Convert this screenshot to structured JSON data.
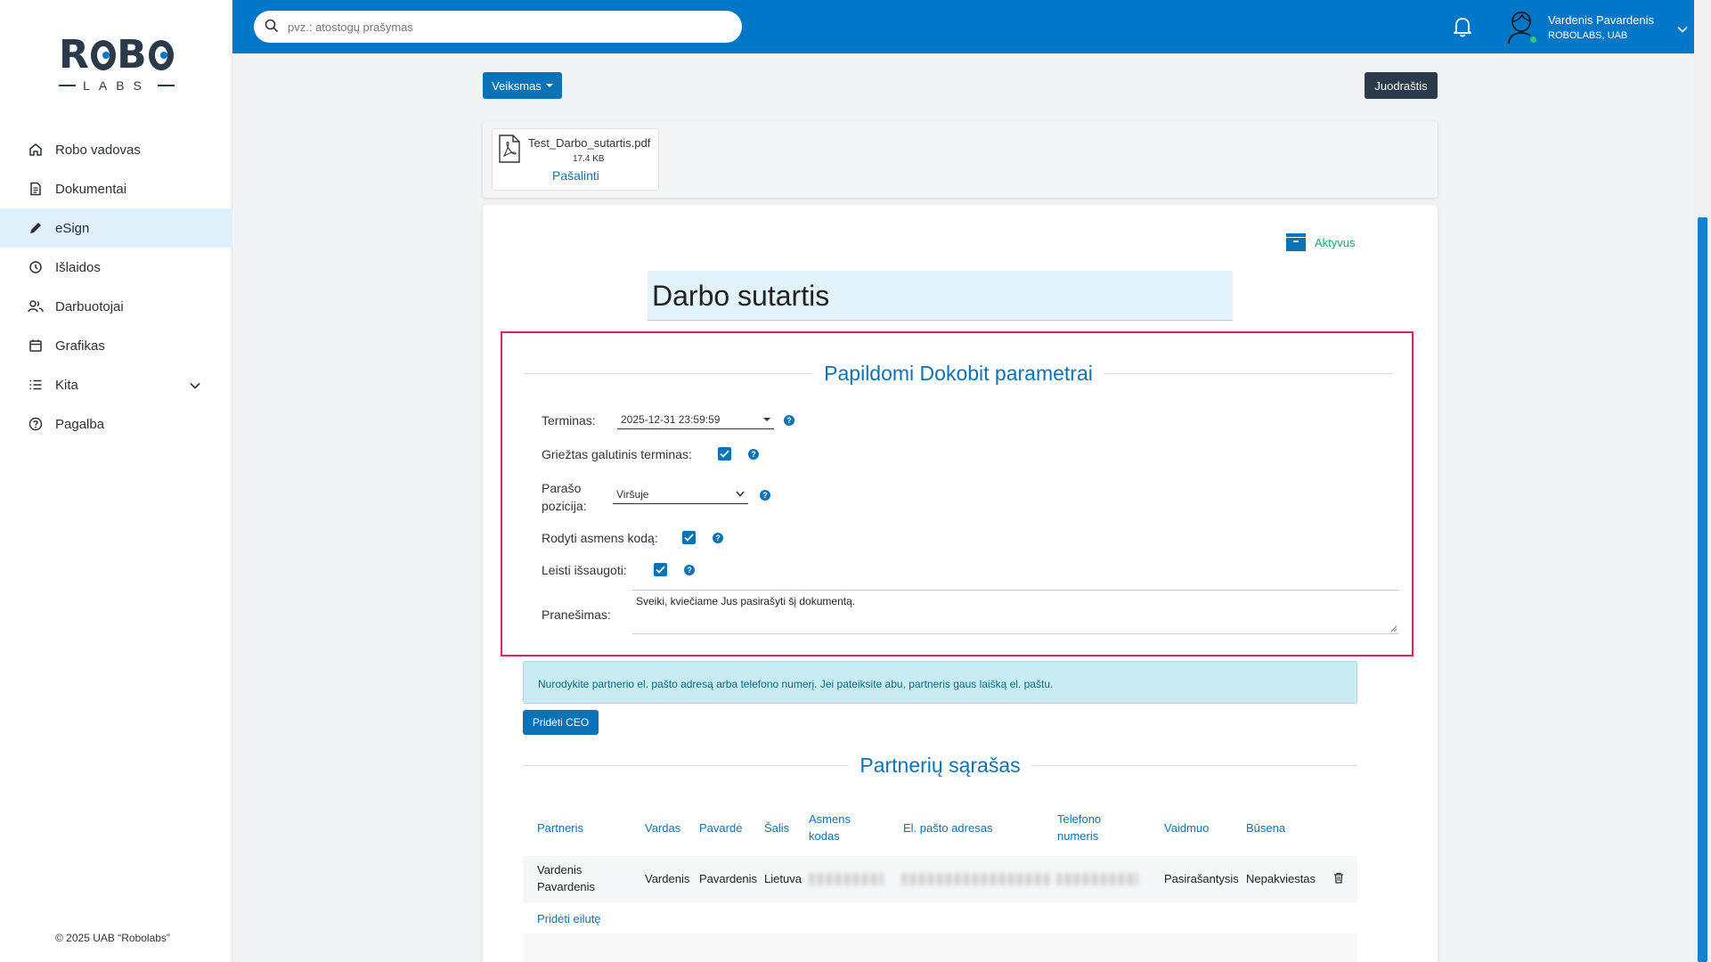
{
  "app": {
    "logo_top": "ROBO",
    "logo_bottom": "LABS",
    "copyright": "© 2025 UAB “Robolabs”"
  },
  "sidebar": {
    "items": [
      {
        "label": "Robo vadovas",
        "icon": "home-icon"
      },
      {
        "label": "Dokumentai",
        "icon": "document-icon"
      },
      {
        "label": "eSign",
        "icon": "pen-icon"
      },
      {
        "label": "Išlaidos",
        "icon": "expenses-icon"
      },
      {
        "label": "Darbuotojai",
        "icon": "users-icon"
      },
      {
        "label": "Grafikas",
        "icon": "calendar-icon"
      },
      {
        "label": "Kita",
        "icon": "list-icon"
      },
      {
        "label": "Pagalba",
        "icon": "help-circle-icon"
      }
    ]
  },
  "header": {
    "search_placeholder": "pvz.: atostogų prašymas",
    "user_name": "Vardenis Pavardenis",
    "user_company": "ROBOLABS, UAB"
  },
  "toolbar": {
    "actions_label": "Veiksmas",
    "history_label": "Juodraštis"
  },
  "attachment": {
    "file_name": "Test_Darbo_sutartis.pdf",
    "file_size": "17.4 KB",
    "remove_label": "Pašalinti"
  },
  "document": {
    "status": "Aktyvus",
    "title": "Darbo sutartis"
  },
  "dokobit": {
    "section_title": "Papildomi Dokobit parametrai",
    "deadline_label": "Terminas:",
    "deadline_value": "2025-12-31 23:59:59",
    "strict_label": "Griežtas galutinis terminas:",
    "position_label_1": "Parašo",
    "position_label_2": "pozicija:",
    "position_value": "Viršuje",
    "show_code_label": "Rodyti asmens kodą:",
    "allow_save_label": "Leisti išsaugoti:",
    "message_label": "Pranešimas:",
    "message_value": "Sveiki, kviečiame Jus pasirašyti šį dokumentą."
  },
  "info_text": "Nurodykite partnerio el. pašto adresą arba telefono numerį. Jei pateiksite abu, partneris gaus laišką el. paštu.",
  "add_ceo_label": "Pridėti CEO",
  "partners": {
    "section_title": "Partnerių sąrašas",
    "columns": {
      "partner": "Partneris",
      "first_name": "Vardas",
      "last_name": "Pavardė",
      "country": "Šalis",
      "code_1": "Asmens",
      "code_2": "kodas",
      "email": "El. pašto adresas",
      "phone_1": "Telefono",
      "phone_2": "numeris",
      "role": "Vaidmuo",
      "status": "Būsena"
    },
    "rows": [
      {
        "partner_1": "Vardenis",
        "partner_2": "Pavardenis",
        "first_name": "Vardenis",
        "last_name": "Pavardenis",
        "country": "Lietuva",
        "role": "Pasirašantysis",
        "status": "Nepakviestas"
      }
    ],
    "add_row_label": "Pridėti eilutę"
  },
  "colors": {
    "primary": "#0a73b7",
    "header": "#0077c8",
    "dark": "#2b3a4a",
    "highlight": "#e3206e",
    "active_status": "#1ea36b"
  }
}
